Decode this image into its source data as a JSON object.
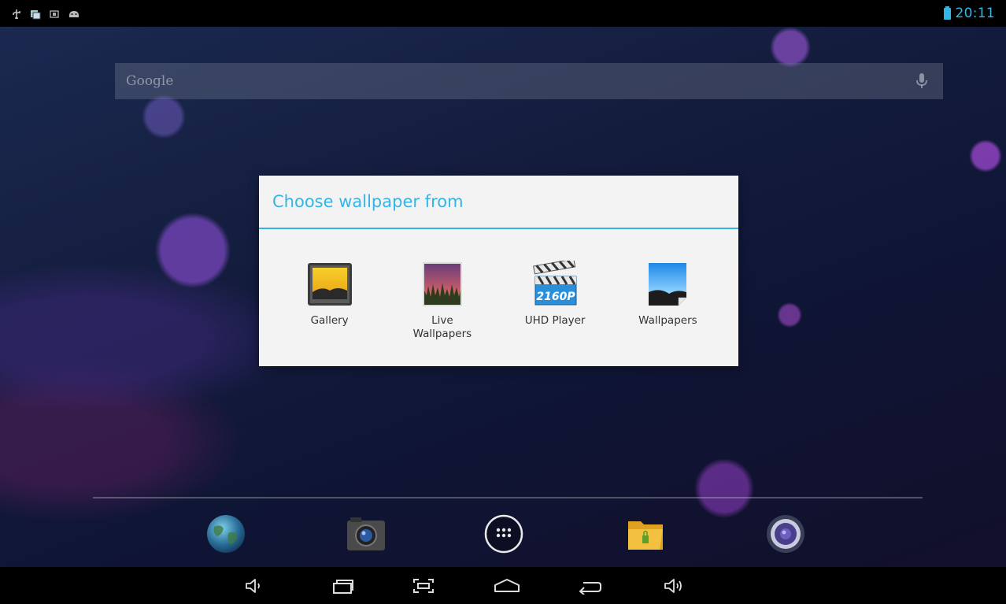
{
  "status_bar": {
    "clock": "20:11",
    "left_icons": [
      "usb-icon",
      "notification-icon",
      "screenshot-icon",
      "android-debug-icon"
    ],
    "battery_color": "#33b5e5"
  },
  "search": {
    "placeholder": "Google"
  },
  "dialog": {
    "title": "Choose wallpaper from",
    "accent_color": "#33b5e5",
    "options": [
      {
        "label": "Gallery",
        "icon": "gallery-icon"
      },
      {
        "label": "Live\nWallpapers",
        "icon": "live-wallpapers-icon"
      },
      {
        "label": "UHD Player",
        "icon": "uhd-player-icon",
        "icon_text": "2160P"
      },
      {
        "label": "Wallpapers",
        "icon": "wallpapers-icon"
      }
    ]
  },
  "dock": {
    "items": [
      "browser-globe-icon",
      "camera-icon",
      "app-drawer-icon",
      "file-manager-icon",
      "music-speaker-icon"
    ]
  },
  "nav_bar": {
    "buttons": [
      "volume-down-icon",
      "recent-apps-icon",
      "screenshot-frame-icon",
      "home-icon",
      "back-icon",
      "volume-up-icon"
    ]
  }
}
